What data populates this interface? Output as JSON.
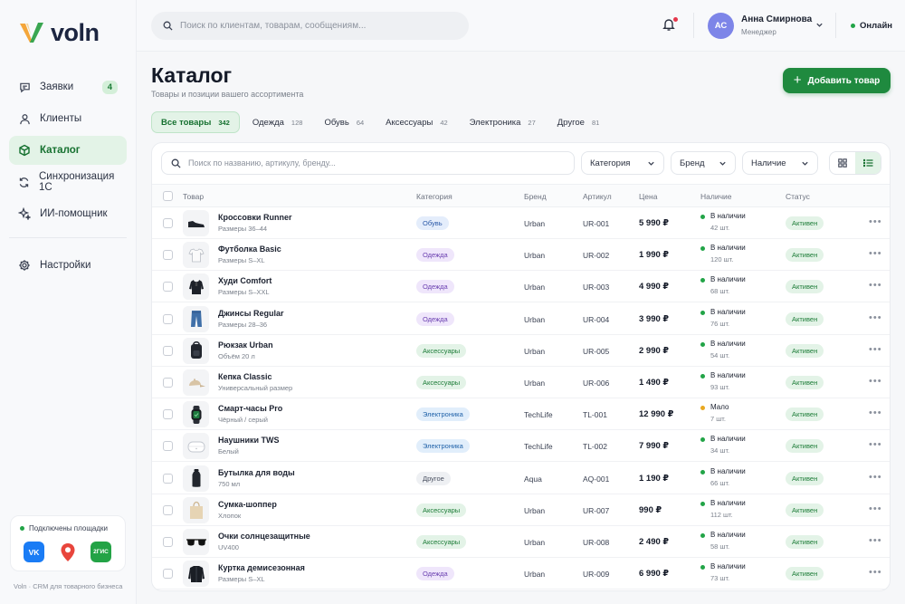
{
  "app": {
    "name": "voln",
    "footer": "Voln · CRM для товарного бизнеса"
  },
  "colors": {
    "accent": "#1f8a3f",
    "accent_light": "#e3f3e7",
    "avatar": "#7d85e8"
  },
  "sidebar": {
    "items": [
      {
        "label": "Заявки",
        "icon": "chat-icon",
        "badge": "4"
      },
      {
        "label": "Клиенты",
        "icon": "user-icon"
      },
      {
        "label": "Каталог",
        "icon": "cube-icon",
        "active": true
      },
      {
        "label": "Синхронизация 1С",
        "icon": "sync-icon"
      },
      {
        "label": "ИИ-помощник",
        "icon": "sparkle-icon"
      }
    ],
    "settings": {
      "label": "Настройки",
      "icon": "gear-icon"
    },
    "platforms": {
      "title": "Подключены площадки",
      "vk": "VK",
      "gis": "2ГИС"
    }
  },
  "topbar": {
    "search_placeholder": "Поиск по клиентам, товарам, сообщениям...",
    "user": {
      "initials": "АС",
      "name": "Анна Смирнова",
      "role": "Менеджер"
    },
    "status": "Онлайн"
  },
  "header": {
    "title": "Каталог",
    "subtitle": "Товары и позиции вашего ассортимента",
    "add_button": "Добавить товар"
  },
  "tabs": [
    {
      "label": "Все товары",
      "count": "342",
      "active": true
    },
    {
      "label": "Одежда",
      "count": "128"
    },
    {
      "label": "Обувь",
      "count": "64"
    },
    {
      "label": "Аксессуары",
      "count": "42"
    },
    {
      "label": "Электроника",
      "count": "27"
    },
    {
      "label": "Другое",
      "count": "81"
    }
  ],
  "filters": {
    "search_placeholder": "Поиск по названию, артикулу, бренду...",
    "category": "Категория",
    "brand": "Бренд",
    "stock": "Наличие"
  },
  "table": {
    "columns": [
      "Товар",
      "Категория",
      "Бренд",
      "Артикул",
      "Цена",
      "Наличие",
      "Статус"
    ],
    "rows": [
      {
        "icon": "sneaker-icon",
        "name": "Кроссовки Runner",
        "sub": "Размеры 36–44",
        "category": "Обувь",
        "brand": "Urban",
        "sku": "UR-001",
        "price": "5 990 ₽",
        "stock": "В наличии",
        "qty": "42 шт.",
        "stock_level": "ok",
        "status": "Активен"
      },
      {
        "icon": "tshirt-icon",
        "name": "Футболка Basic",
        "sub": "Размеры S–XL",
        "category": "Одежда",
        "brand": "Urban",
        "sku": "UR-002",
        "price": "1 990 ₽",
        "stock": "В наличии",
        "qty": "120 шт.",
        "stock_level": "ok",
        "status": "Активен"
      },
      {
        "icon": "hoodie-icon",
        "name": "Худи Comfort",
        "sub": "Размеры S–XXL",
        "category": "Одежда",
        "brand": "Urban",
        "sku": "UR-003",
        "price": "4 990 ₽",
        "stock": "В наличии",
        "qty": "68 шт.",
        "stock_level": "ok",
        "status": "Активен"
      },
      {
        "icon": "jeans-icon",
        "name": "Джинсы Regular",
        "sub": "Размеры 28–36",
        "category": "Одежда",
        "brand": "Urban",
        "sku": "UR-004",
        "price": "3 990 ₽",
        "stock": "В наличии",
        "qty": "76 шт.",
        "stock_level": "ok",
        "status": "Активен"
      },
      {
        "icon": "backpack-icon",
        "name": "Рюкзак Urban",
        "sub": "Объём 20 л",
        "category": "Аксессуары",
        "brand": "Urban",
        "sku": "UR-005",
        "price": "2 990 ₽",
        "stock": "В наличии",
        "qty": "54 шт.",
        "stock_level": "ok",
        "status": "Активен"
      },
      {
        "icon": "cap-icon",
        "name": "Кепка Classic",
        "sub": "Универсальный размер",
        "category": "Аксессуары",
        "brand": "Urban",
        "sku": "UR-006",
        "price": "1 490 ₽",
        "stock": "В наличии",
        "qty": "93 шт.",
        "stock_level": "ok",
        "status": "Активен"
      },
      {
        "icon": "smartwatch-icon",
        "name": "Смарт-часы Pro",
        "sub": "Чёрный / серый",
        "category": "Электроника",
        "brand": "TechLife",
        "sku": "TL-001",
        "price": "12 990 ₽",
        "stock": "Мало",
        "qty": "7 шт.",
        "stock_level": "low",
        "status": "Активен"
      },
      {
        "icon": "earbuds-icon",
        "name": "Наушники TWS",
        "sub": "Белый",
        "category": "Электроника",
        "brand": "TechLife",
        "sku": "TL-002",
        "price": "7 990 ₽",
        "stock": "В наличии",
        "qty": "34 шт.",
        "stock_level": "ok",
        "status": "Активен"
      },
      {
        "icon": "bottle-icon",
        "name": "Бутылка для воды",
        "sub": "750 мл",
        "category": "Другое",
        "brand": "Aqua",
        "sku": "AQ-001",
        "price": "1 190 ₽",
        "stock": "В наличии",
        "qty": "66 шт.",
        "stock_level": "ok",
        "status": "Активен"
      },
      {
        "icon": "tote-bag-icon",
        "name": "Сумка-шоппер",
        "sub": "Хлопок",
        "category": "Аксессуары",
        "brand": "Urban",
        "sku": "UR-007",
        "price": "990 ₽",
        "stock": "В наличии",
        "qty": "112 шт.",
        "stock_level": "ok",
        "status": "Активен"
      },
      {
        "icon": "sunglasses-icon",
        "name": "Очки солнцезащитные",
        "sub": "UV400",
        "category": "Аксессуары",
        "brand": "Urban",
        "sku": "UR-008",
        "price": "2 490 ₽",
        "stock": "В наличии",
        "qty": "58 шт.",
        "stock_level": "ok",
        "status": "Активен"
      },
      {
        "icon": "jacket-icon",
        "name": "Куртка демисезонная",
        "sub": "Размеры S–XL",
        "category": "Одежда",
        "brand": "Urban",
        "sku": "UR-009",
        "price": "6 990 ₽",
        "stock": "В наличии",
        "qty": "73 шт.",
        "stock_level": "ok",
        "status": "Активен"
      }
    ]
  }
}
